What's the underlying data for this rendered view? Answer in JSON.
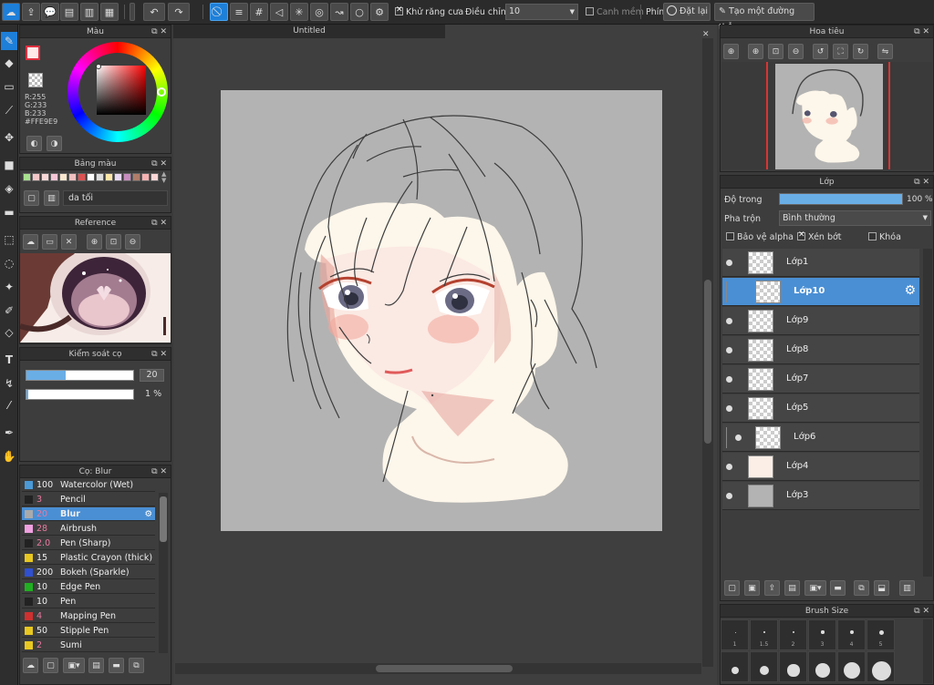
{
  "toolbar": {
    "antialias_label": "Khử răng cưa",
    "adjust_label": "Điều chỉnh",
    "adjust_value": "10",
    "soft_edge_label": "Canh mềm",
    "keys_label": "Phím",
    "reset_label": "Đặt lại",
    "straight_line_label": "Tạo một đường thẳng"
  },
  "color_panel": {
    "title": "Màu",
    "r": "R:255",
    "g": "G:233",
    "b": "B:233",
    "hex": "#FFE9E9",
    "primary_color": "#FFE9E9",
    "accent": "#1E7FD9"
  },
  "palette_panel": {
    "title": "Bảng màu",
    "name": "da tối",
    "swatches": [
      "#a8e090",
      "#f3c8c8",
      "#f7d7d7",
      "#f4c6d6",
      "#fbe8d0",
      "#f0c0c0",
      "#e05050",
      "#fff",
      "#ddd",
      "#fde7a8",
      "#e9d9f5",
      "#c98cc0",
      "#b07d6a",
      "#f7b2b2",
      "#fcd6d6"
    ]
  },
  "reference_panel": {
    "title": "Reference"
  },
  "brush_control": {
    "title": "Kiểm soát cọ",
    "size": "20",
    "opacity": "1 %",
    "size_fraction": 0.37,
    "opacity_fraction": 1.0
  },
  "brush_panel": {
    "title": "Cọ: Blur",
    "items": [
      {
        "num": "100",
        "name": "Watercolor (Wet)",
        "color": "#4a9ad8"
      },
      {
        "num": "3",
        "name": "Pencil",
        "color": "#222"
      },
      {
        "num": "20",
        "name": "Blur",
        "color": "#aaa"
      },
      {
        "num": "28",
        "name": "Airbrush",
        "color": "#f0a0e0"
      },
      {
        "num": "2.0",
        "name": "Pen (Sharp)",
        "color": "#222"
      },
      {
        "num": "15",
        "name": "Plastic Crayon (thick)",
        "color": "#e8c820"
      },
      {
        "num": "200",
        "name": "Bokeh (Sparkle)",
        "color": "#3050d0"
      },
      {
        "num": "10",
        "name": "Edge Pen",
        "color": "#20b020"
      },
      {
        "num": "10",
        "name": "Pen",
        "color": "#222"
      },
      {
        "num": "4",
        "name": "Mapping Pen",
        "color": "#d03030"
      },
      {
        "num": "50",
        "name": "Stipple Pen",
        "color": "#e8c820"
      },
      {
        "num": "2",
        "name": "Sumi",
        "color": "#e8c820"
      }
    ]
  },
  "document": {
    "title": "Untitled"
  },
  "navigator": {
    "title": "Hoa tiêu"
  },
  "layer_panel": {
    "title": "Lớp",
    "opacity_label": "Độ trong",
    "opacity_value": "100 %",
    "opacity_fraction": 1.0,
    "blend_label": "Pha trộn",
    "blend_value": "Bình thường",
    "protect_alpha": "Bảo vệ alpha",
    "clipping": "Xén bớt",
    "lock": "Khóa",
    "layers": [
      {
        "name": "Lớp1"
      },
      {
        "name": "Lớp10"
      },
      {
        "name": "Lớp9"
      },
      {
        "name": "Lớp8"
      },
      {
        "name": "Lớp7"
      },
      {
        "name": "Lớp5"
      },
      {
        "name": "Lớp6"
      },
      {
        "name": "Lớp4"
      },
      {
        "name": "Lớp3"
      }
    ]
  },
  "brush_size_panel": {
    "title": "Brush Size",
    "sizes": [
      "1",
      "1.5",
      "2",
      "3",
      "4",
      "5"
    ]
  }
}
